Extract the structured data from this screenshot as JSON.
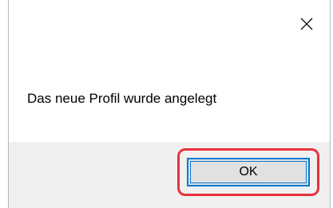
{
  "dialog": {
    "message": "Das neue Profil wurde angelegt",
    "close_glyph": "✕",
    "ok_label": "OK"
  },
  "colors": {
    "highlight": "#e8323c",
    "focus_border": "#0078d7",
    "footer_bg": "#f0f0f0",
    "button_bg": "#e1e1e1"
  },
  "icons": {
    "close": "close-icon"
  }
}
